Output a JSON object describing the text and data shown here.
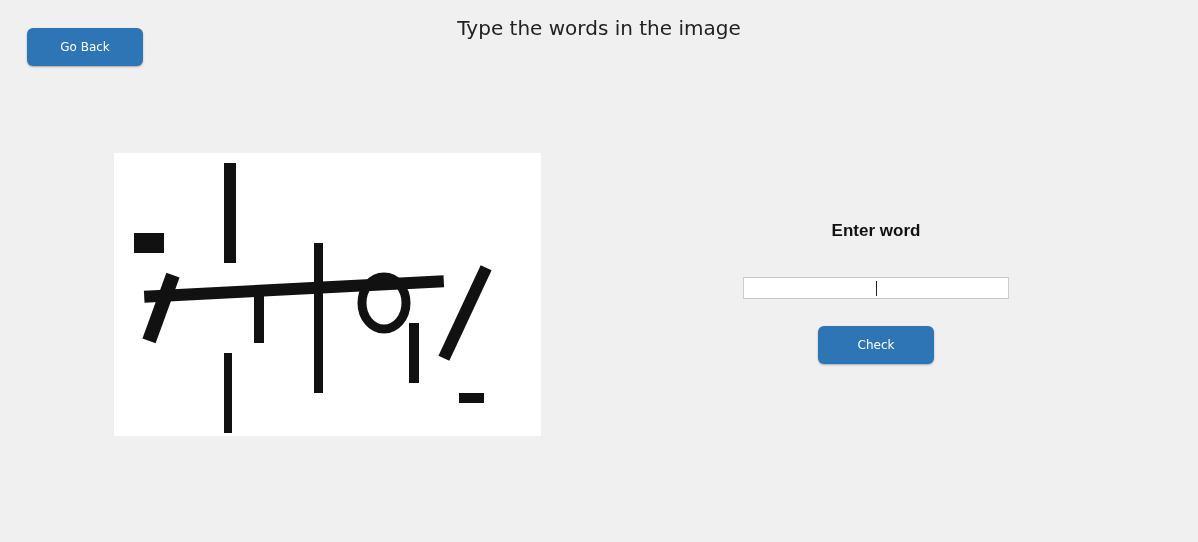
{
  "back_button": {
    "label": "Go Back"
  },
  "title": "Type the words in the image",
  "form": {
    "label": "Enter word",
    "check_button": {
      "label": "Check"
    }
  }
}
